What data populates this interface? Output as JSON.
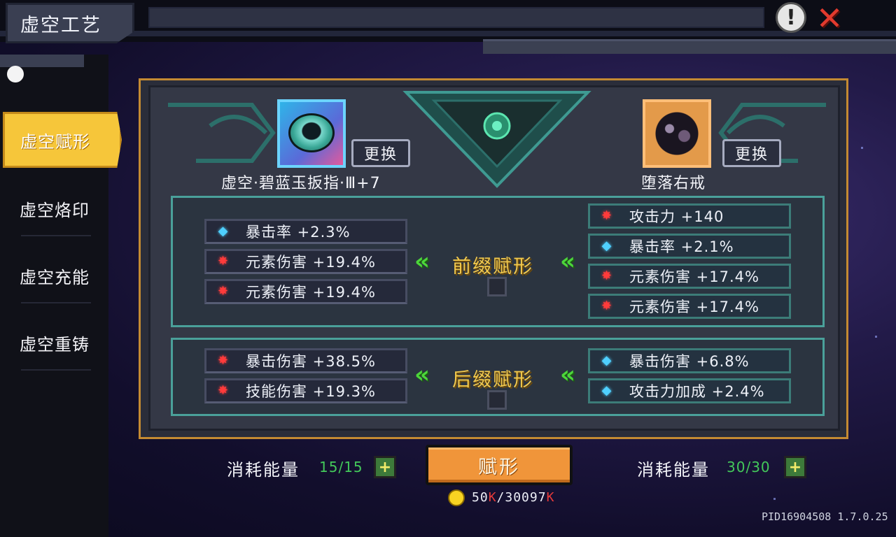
{
  "header": {
    "title": "虚空工艺",
    "info_icon": "exclamation-icon",
    "close_icon": "close-x-icon"
  },
  "sidebar": {
    "items": [
      {
        "label": "虚空赋形",
        "active": true
      },
      {
        "label": "虚空烙印",
        "active": false
      },
      {
        "label": "虚空充能",
        "active": false
      },
      {
        "label": "虚空重铸",
        "active": false
      }
    ]
  },
  "items": {
    "left": {
      "name": "虚空·碧蓝玉扳指·Ⅲ+7",
      "swap_label": "更换",
      "icon": "jade-ring-icon"
    },
    "right": {
      "name": "堕落右戒",
      "swap_label": "更换",
      "icon": "fallen-ring-icon"
    }
  },
  "prefix": {
    "label": "前缀赋形",
    "left_stats": [
      {
        "text": "暴击率 +2.3%",
        "gem": "blue"
      },
      {
        "text": "元素伤害 +19.4%",
        "gem": "red"
      },
      {
        "text": "元素伤害 +19.4%",
        "gem": "red"
      }
    ],
    "right_stats": [
      {
        "text": "攻击力 +140",
        "gem": "red"
      },
      {
        "text": "暴击率 +2.1%",
        "gem": "blue"
      },
      {
        "text": "元素伤害 +17.4%",
        "gem": "red"
      },
      {
        "text": "元素伤害 +17.4%",
        "gem": "red"
      }
    ]
  },
  "suffix": {
    "label": "后缀赋形",
    "left_stats": [
      {
        "text": "暴击伤害 +38.5%",
        "gem": "red"
      },
      {
        "text": "技能伤害 +19.3%",
        "gem": "red"
      }
    ],
    "right_stats": [
      {
        "text": "暴击伤害 +6.8%",
        "gem": "blue"
      },
      {
        "text": "攻击力加成 +2.4%",
        "gem": "blue"
      }
    ]
  },
  "bottom": {
    "energy_label": "消耗能量",
    "left_energy": "15/15",
    "right_energy": "30/30",
    "forge_button": "赋形",
    "cost_current": "50",
    "cost_separator": "/",
    "cost_total": "30097",
    "cost_unit": "K",
    "version": "PID16904508 1.7.0.25"
  },
  "colors": {
    "accent_gold": "#f2c94c",
    "gem_red": "#ff3b3b",
    "gem_blue": "#4fd0ff",
    "energy_green": "#43c85a",
    "forge_orange": "#f0953a"
  }
}
